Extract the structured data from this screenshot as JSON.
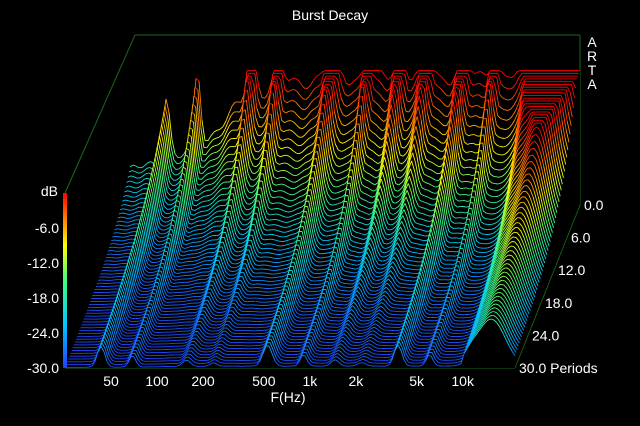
{
  "chart_data": {
    "type": "waterfall",
    "title": "Burst Decay",
    "watermark": "ARTA",
    "xlabel": "F(Hz)",
    "ylabel": "dB",
    "zlabel": "Periods",
    "x_scale": "log",
    "x_ticks": [
      "50",
      "100",
      "200",
      "500",
      "1k",
      "2k",
      "5k",
      "10k"
    ],
    "y_ticks": [
      "-6.0",
      "-12.0",
      "-18.0",
      "-24.0",
      "-30.0"
    ],
    "z_ticks": [
      "0.0",
      "6.0",
      "12.0",
      "18.0",
      "24.0",
      "30.0 Periods"
    ],
    "ylim": [
      -30,
      0
    ],
    "zlim": [
      0,
      30
    ],
    "colormap": [
      "#2040ff",
      "#00c8ff",
      "#40ff80",
      "#ffff00",
      "#ff8000",
      "#ff0000"
    ],
    "grid": false
  },
  "colors": {
    "background": "#000000",
    "frame": "#1a6a1a",
    "text": "#ffffff"
  }
}
